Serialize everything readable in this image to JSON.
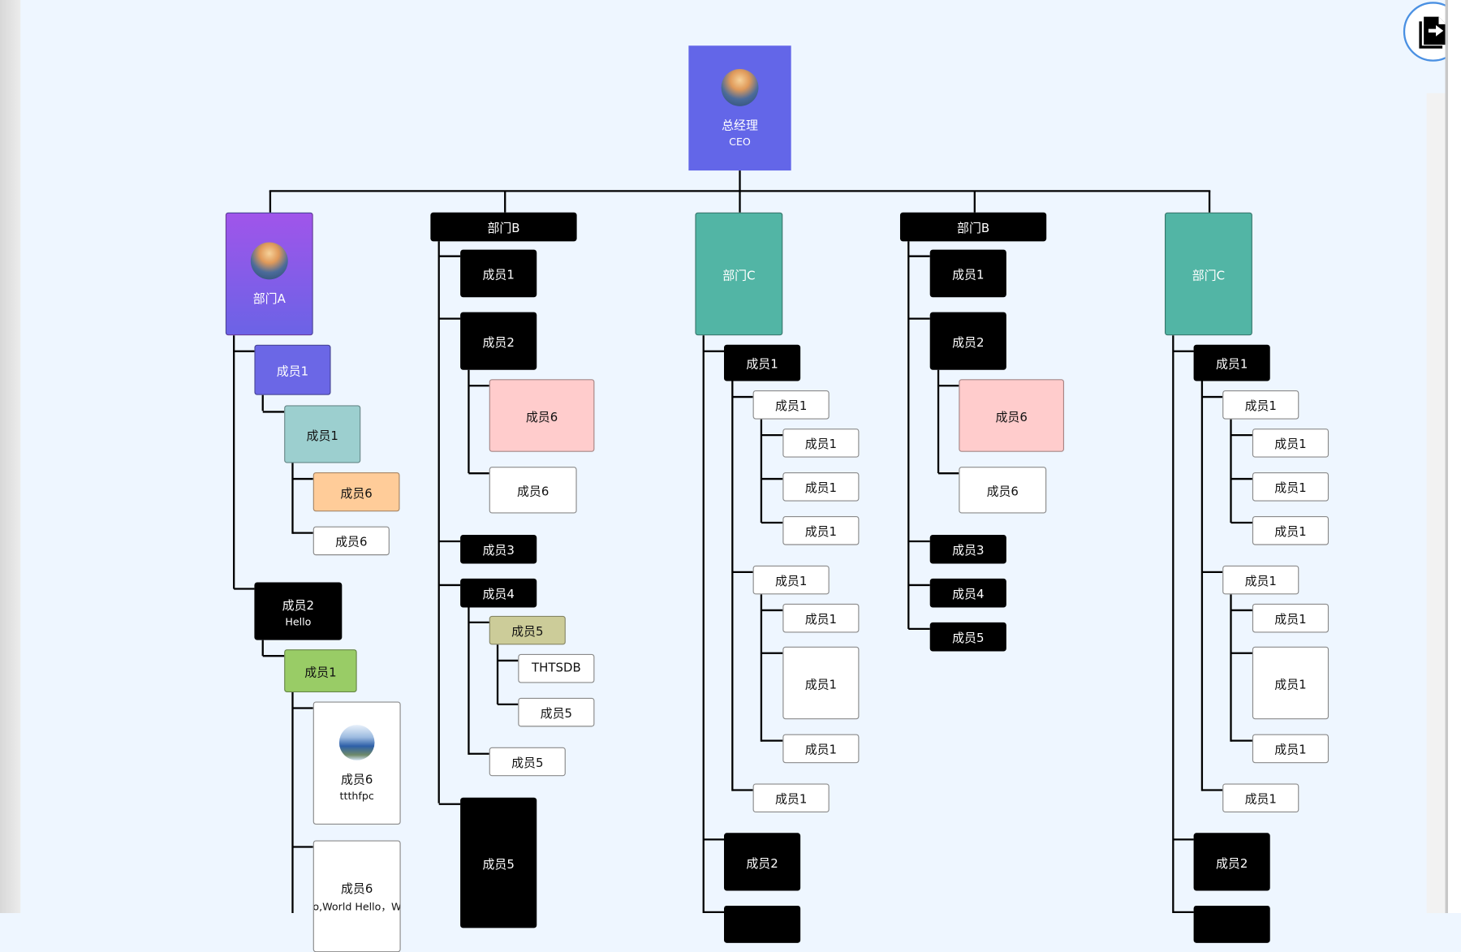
{
  "ceo": {
    "title": "总经理",
    "subtitle": "CEO",
    "color": "#6366e8"
  },
  "nodes": [
    {
      "label": "部门A",
      "color": "#9b59e8"
    },
    {
      "label": "成员1",
      "color": "#6b67e6"
    },
    {
      "label": "成员1",
      "color": "#9ccfcf"
    },
    {
      "label": "成员6",
      "color": "#ffcc99"
    },
    {
      "label": "成员6",
      "color": "#ffffff"
    },
    {
      "label": "成员2",
      "sub": "Hello",
      "color": "#000000"
    },
    {
      "label": "成员1",
      "color": "#99cc66"
    },
    {
      "label": "成员6",
      "sub": "ttthfpc",
      "color": "#ffffff"
    },
    {
      "label": "成员6",
      "sub": "Hello,World Hello，World",
      "color": "#ffffff"
    },
    {
      "label": "部门B",
      "color": "#000000"
    },
    {
      "label": "成员1",
      "color": "#000000"
    },
    {
      "label": "成员2",
      "color": "#000000"
    },
    {
      "label": "成员6",
      "color": "#ffcccc"
    },
    {
      "label": "成员6",
      "color": "#ffffff"
    },
    {
      "label": "成员3",
      "color": "#000000"
    },
    {
      "label": "成员4",
      "color": "#000000"
    },
    {
      "label": "成员5",
      "color": "#cccc99"
    },
    {
      "label": "THTSDB",
      "color": "#ffffff"
    },
    {
      "label": "成员5",
      "color": "#ffffff"
    },
    {
      "label": "成员5",
      "color": "#ffffff"
    },
    {
      "label": "成员5",
      "color": "#000000"
    },
    {
      "label": "部门C",
      "color": "#52b5a5"
    },
    {
      "label": "成员1",
      "color": "#000000"
    },
    {
      "label": "成员1",
      "color": "#ffffff"
    },
    {
      "label": "成员1",
      "color": "#ffffff"
    },
    {
      "label": "成员1",
      "color": "#ffffff"
    },
    {
      "label": "成员1",
      "color": "#ffffff"
    },
    {
      "label": "成员1",
      "color": "#ffffff"
    },
    {
      "label": "成员1",
      "color": "#ffffff"
    },
    {
      "label": "成员1",
      "color": "#ffffff"
    },
    {
      "label": "成员1",
      "color": "#ffffff"
    },
    {
      "label": "成员1",
      "color": "#ffffff"
    },
    {
      "label": "成员2",
      "color": "#000000"
    },
    {
      "label": "",
      "color": "#000000"
    },
    {
      "label": "部门B",
      "color": "#000000"
    },
    {
      "label": "成员1",
      "color": "#000000"
    },
    {
      "label": "成员2",
      "color": "#000000"
    },
    {
      "label": "成员6",
      "color": "#ffcccc"
    },
    {
      "label": "成员6",
      "color": "#ffffff"
    },
    {
      "label": "成员3",
      "color": "#000000"
    },
    {
      "label": "成员4",
      "color": "#000000"
    },
    {
      "label": "成员5",
      "color": "#000000"
    },
    {
      "label": "部门C",
      "color": "#52b5a5"
    },
    {
      "label": "成员1",
      "color": "#000000"
    },
    {
      "label": "成员1",
      "color": "#ffffff"
    },
    {
      "label": "成员1",
      "color": "#ffffff"
    },
    {
      "label": "成员1",
      "color": "#ffffff"
    },
    {
      "label": "成员1",
      "color": "#ffffff"
    },
    {
      "label": "成员1",
      "color": "#ffffff"
    },
    {
      "label": "成员1",
      "color": "#ffffff"
    },
    {
      "label": "成员1",
      "color": "#ffffff"
    },
    {
      "label": "成员1",
      "color": "#ffffff"
    },
    {
      "label": "成员1",
      "color": "#ffffff"
    },
    {
      "label": "成员2",
      "color": "#000000"
    },
    {
      "label": "",
      "color": "#000000"
    }
  ],
  "export_button": {
    "icon": "file-export-icon"
  }
}
